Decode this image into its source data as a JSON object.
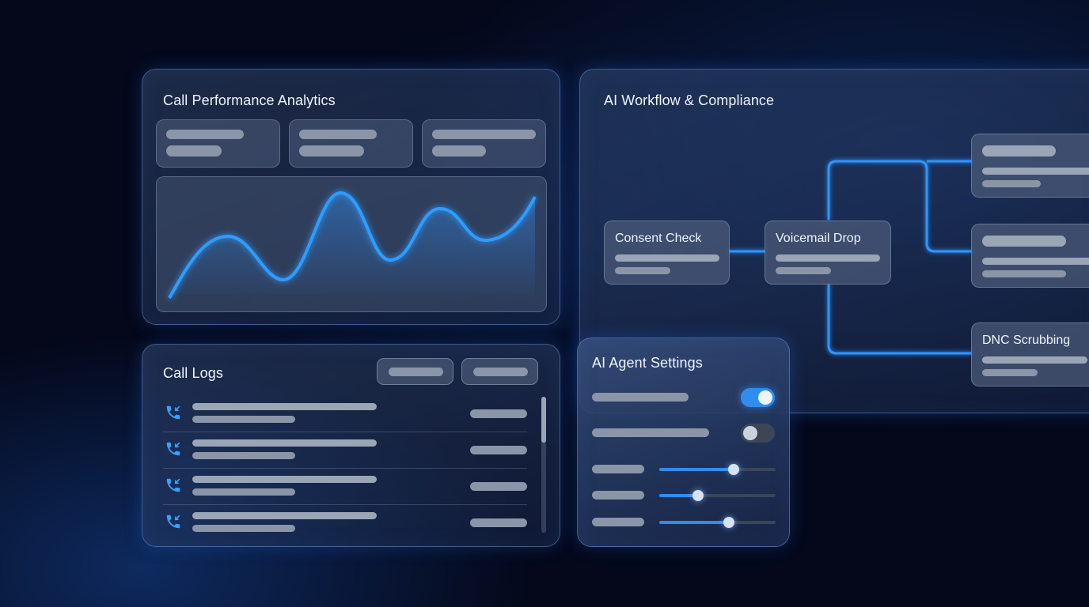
{
  "analytics": {
    "title": "Call Performance Analytics"
  },
  "workflow": {
    "title": "AI Workflow & Compliance",
    "nodes": [
      "Consent Check",
      "Voicemail Drop",
      "DNC Scrubbing"
    ]
  },
  "logs": {
    "title": "Call Logs",
    "icon": "phone-incoming-icon"
  },
  "settings": {
    "title": "AI Agent Settings",
    "toggles": [
      true,
      false
    ],
    "sliders": [
      0.64,
      0.33,
      0.6
    ]
  },
  "colors": {
    "accent": "#2f95ff",
    "background": "#04081a"
  }
}
